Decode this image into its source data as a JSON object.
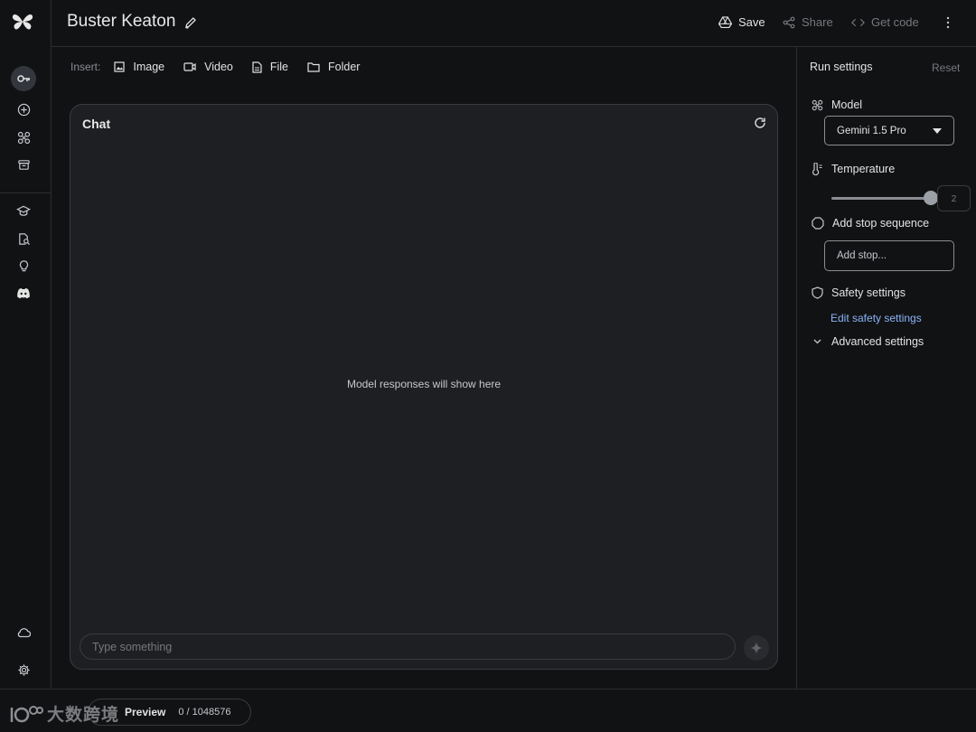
{
  "header": {
    "title": "Buster Keaton",
    "save_label": "Save",
    "share_label": "Share",
    "code_label": "Get code"
  },
  "rail": {
    "icons": [
      "key-icon",
      "add-circle-icon",
      "model-tune-icon",
      "archive-icon",
      "school-icon",
      "search-doc-icon",
      "lightbulb-icon",
      "discord-icon",
      "cloud-icon",
      "settings-icon"
    ]
  },
  "insert": {
    "label": "Insert:",
    "image": "Image",
    "video": "Video",
    "file": "File",
    "folder": "Folder"
  },
  "chat": {
    "title": "Chat",
    "empty_message": "Model responses will show here",
    "input_placeholder": "Type something"
  },
  "settings": {
    "title": "Run settings",
    "reset": "Reset",
    "model_label": "Model",
    "model_value": "Gemini 1.5 Pro",
    "temperature_label": "Temperature",
    "temperature_value": "2",
    "temperature_fraction": 1.0,
    "stop_label": "Add stop sequence",
    "stop_placeholder": "Add stop...",
    "safety_label": "Safety settings",
    "safety_link": "Edit safety settings",
    "advanced_label": "Advanced settings"
  },
  "bottom": {
    "preview_label": "Preview",
    "token_count": "0 / 1048576",
    "watermark_text": "大数跨境"
  },
  "colors": {
    "background": "#111214",
    "panel": "#1e1f22",
    "link": "#8ab4f8"
  }
}
